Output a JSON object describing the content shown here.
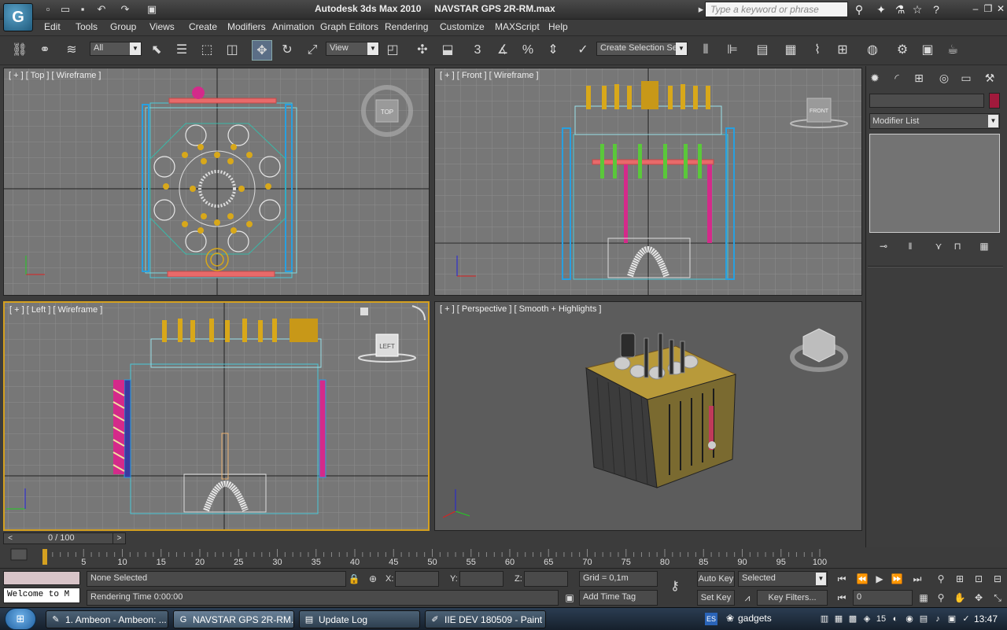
{
  "window": {
    "app_title": "Autodesk 3ds Max  2010",
    "file_title": "NAVSTAR GPS 2R-RM.max",
    "search_placeholder": "Type a keyword or phrase"
  },
  "menu": [
    "Edit",
    "Tools",
    "Group",
    "Views",
    "Create",
    "Modifiers",
    "Animation",
    "Graph Editors",
    "Rendering",
    "Customize",
    "MAXScript",
    "Help"
  ],
  "toolbar": {
    "filter_value": "All",
    "ref_coord_value": "View",
    "selection_set_placeholder": "Create Selection Se"
  },
  "viewports": {
    "top": {
      "label": "[ + ] [ Top ] [ Wireframe ]",
      "cube_label": "TOP"
    },
    "front": {
      "label": "[ + ] [ Front ] [ Wireframe ]",
      "cube_label": "FRONT"
    },
    "left": {
      "label": "[ + ] [ Left ] [ Wireframe ]",
      "cube_label": "LEFT"
    },
    "perspective": {
      "label": "[ + ] [ Perspective ] [ Smooth + Highlights ]"
    }
  },
  "command_panel": {
    "modifier_list_label": "Modifier List",
    "object_color": "#a01a3c"
  },
  "timeline": {
    "slider_text": "0 / 100",
    "ticks": [
      "5",
      "10",
      "15",
      "20",
      "25",
      "30",
      "35",
      "40",
      "45",
      "50",
      "55",
      "60",
      "65",
      "70",
      "75",
      "80",
      "85",
      "90",
      "95",
      "100"
    ],
    "current_frame": 0,
    "total_frames": 100
  },
  "status": {
    "maxscript_text": "Welcome to M",
    "selection_text": "None Selected",
    "prompt_text": "Rendering Time  0:00:00",
    "x_label": "X:",
    "y_label": "Y:",
    "z_label": "Z:",
    "grid_text": "Grid = 0,1m",
    "add_time_tag": "Add Time Tag",
    "auto_key": "Auto Key",
    "set_key": "Set Key",
    "selected_value": "Selected",
    "key_filters": "Key Filters...",
    "frame_value": "0"
  },
  "taskbar": {
    "tasks": [
      {
        "label": "1. Ambeon - Ambeon: ...",
        "icon": "✎"
      },
      {
        "label": "NAVSTAR GPS 2R-RM....",
        "icon": "G"
      },
      {
        "label": "Update Log",
        "icon": "▤"
      },
      {
        "label": "IIE DEV 180509 - Paint",
        "icon": "✐"
      }
    ],
    "lang": "ES",
    "gadgets": "gadgets",
    "clock": "13:47"
  }
}
